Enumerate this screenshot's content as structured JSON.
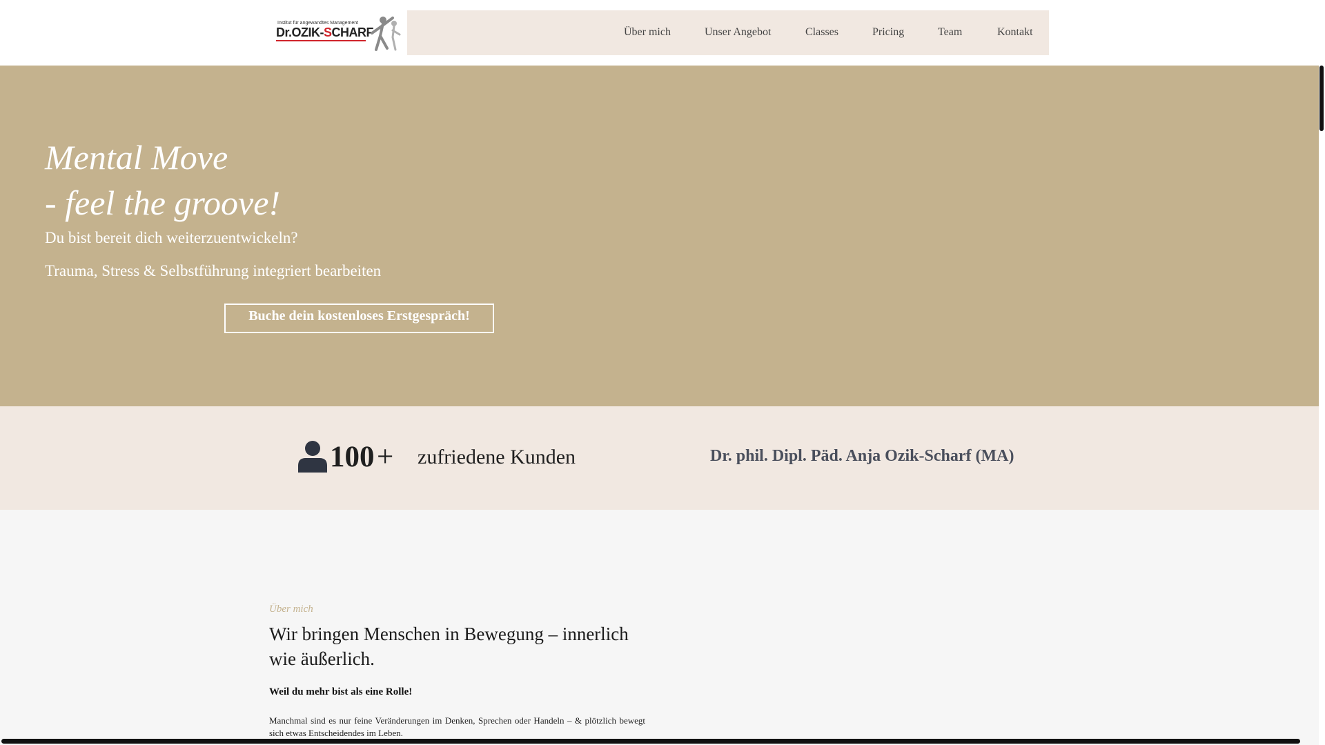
{
  "header": {
    "logo": {
      "small_text": "Institut für angewandtes Management",
      "name_prefix": "Dr.",
      "name_first": "OZIK-",
      "name_red": "S",
      "name_rest": "CHARF",
      "brand_color": "#d0242b"
    },
    "nav": [
      {
        "label": "Über mich"
      },
      {
        "label": "Unser Angebot"
      },
      {
        "label": "Classes"
      },
      {
        "label": "Pricing"
      },
      {
        "label": "Team"
      },
      {
        "label": "Kontakt"
      }
    ]
  },
  "hero": {
    "title_line1": "Mental Move",
    "title_line2": "- feel the groove!",
    "subtitle1": "Du bist bereit dich weiterzuentwickeln?",
    "subtitle2": "Trauma, Stress & Selbstführung integriert bearbeiten",
    "cta_label": "Buche dein kostenloses Erstgespräch!",
    "background_color": "#c4b28e"
  },
  "stats": {
    "icon": "user-icon",
    "number": "100",
    "suffix": "+",
    "label": "zufriedene Kunden",
    "person_name": "Dr. phil. Dipl. Päd. Anja Ozik-Scharf (MA)"
  },
  "about": {
    "eyebrow": "Über mich",
    "heading": "Wir bringen Menschen in Bewegung – innerlich wie äußerlich.",
    "strong": "Weil du mehr bist als eine Rolle!",
    "text": "Manchmal sind es nur feine Veränderungen im Denken, Sprechen oder Handeln – & plötzlich bewegt sich etwas Entscheidendes im Leben.",
    "accent_color": "#c4b28e"
  }
}
